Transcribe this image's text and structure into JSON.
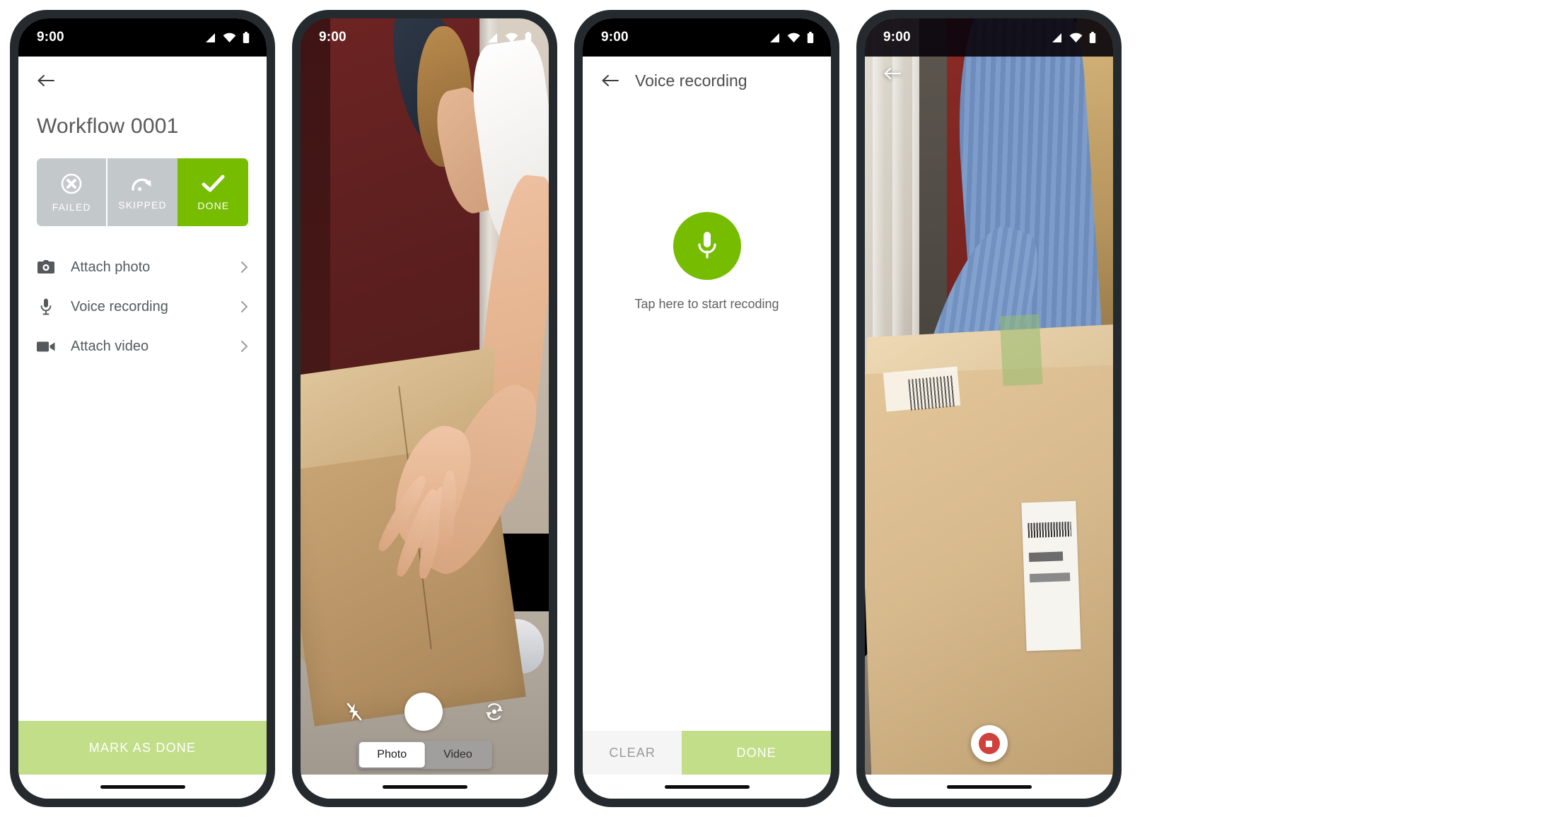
{
  "common": {
    "status_time": "9:00",
    "icons": {
      "signal": "signal-icon",
      "wifi": "wifi-icon",
      "battery": "battery-icon",
      "back": "back-arrow-icon",
      "chevron": "chevron-right-icon"
    },
    "colors": {
      "brand_green": "#76bc00",
      "light_green": "#c2de88",
      "gray_segment": "#c3c8cb",
      "record_red": "#d0413c",
      "frame": "#252a2f"
    }
  },
  "phone1": {
    "screen_name": "workflow-detail",
    "title": "Workflow 0001",
    "status_segments": [
      {
        "label": "FAILED",
        "icon": "failed-circle-x-icon",
        "active": false
      },
      {
        "label": "SKIPPED",
        "icon": "skip-arrow-icon",
        "active": false
      },
      {
        "label": "DONE",
        "icon": "check-icon",
        "active": true
      }
    ],
    "attachments": [
      {
        "label": "Attach photo",
        "icon": "camera-icon"
      },
      {
        "label": "Voice recording",
        "icon": "microphone-icon"
      },
      {
        "label": "Attach video",
        "icon": "video-camera-icon"
      }
    ],
    "primary_action": "MARK AS DONE"
  },
  "phone2": {
    "screen_name": "camera-capture",
    "flash_icon": "flash-off-icon",
    "shutter_icon": "shutter-button",
    "flip_icon": "camera-flip-icon",
    "media_modes": [
      {
        "label": "Photo",
        "active": true
      },
      {
        "label": "Video",
        "active": false
      }
    ]
  },
  "phone3": {
    "screen_name": "voice-recording",
    "app_bar_title": "Voice recording",
    "mic_icon": "microphone-icon",
    "hint": "Tap here to start recoding",
    "actions": [
      {
        "label": "CLEAR",
        "style": "secondary"
      },
      {
        "label": "DONE",
        "style": "primary"
      }
    ]
  },
  "phone4": {
    "screen_name": "video-recording",
    "back_icon": "back-arrow-icon",
    "record_icon": "record-stop-icon"
  }
}
